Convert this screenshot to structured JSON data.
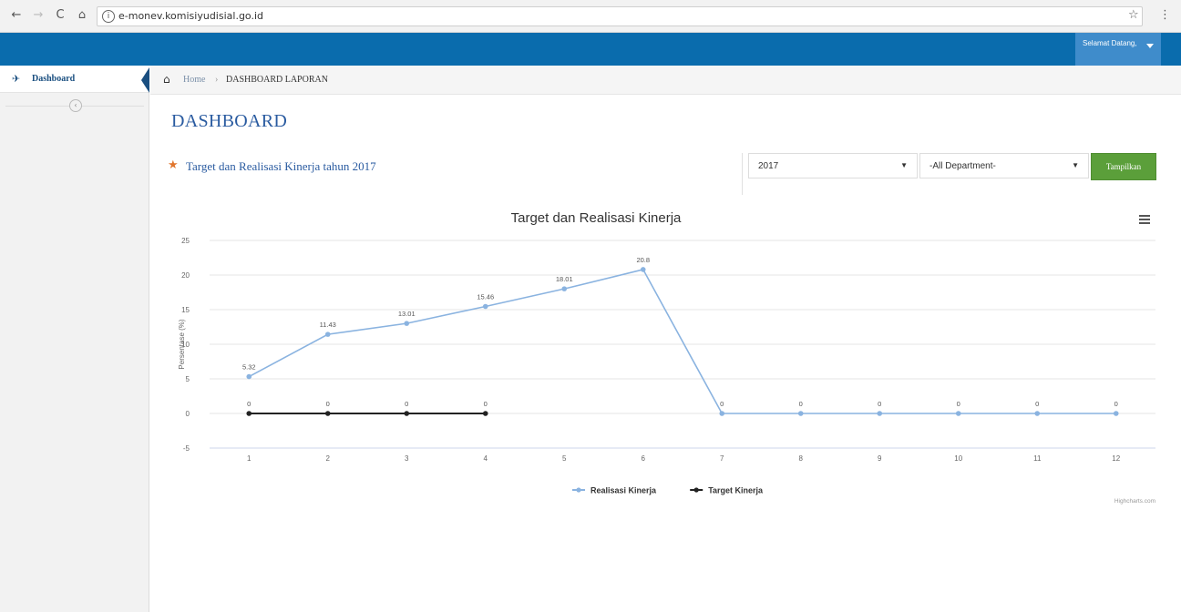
{
  "browser": {
    "back_glyph": "←",
    "forward_glyph": "→",
    "reload_glyph": "C",
    "home_glyph": "⌂",
    "info_glyph": "i",
    "url": "e-monev.komisiyudisial.go.id",
    "bookmark_glyph": "☆",
    "menu_glyph": "⋮"
  },
  "header": {
    "user_label": "Selamat Datang,"
  },
  "sidebar": {
    "items": [
      {
        "label": "Dashboard",
        "icon": "dashboard-icon",
        "glyph": "✈"
      }
    ],
    "collapse_glyph": "‹"
  },
  "breadcrumb": {
    "home_glyph": "⌂",
    "home": "Home",
    "separator": "›",
    "current": "DASHBOARD LAPORAN"
  },
  "main": {
    "title": "DASHBOARD",
    "star_glyph": "★",
    "section_title": "Target dan Realisasi Kinerja tahun 2017",
    "filters": {
      "year": "2017",
      "department": "-All Department-",
      "caret": "▼",
      "button_label": "Tampilkan"
    }
  },
  "colors": {
    "header": "#0a6cad",
    "accent_green": "#5b9f3a",
    "realisasi": "#8ab3e0",
    "target": "#222222"
  },
  "chart_data": {
    "type": "line",
    "title": "Target dan Realisasi Kinerja",
    "xlabel": "",
    "ylabel": "Persentase (%)",
    "categories": [
      "1",
      "2",
      "3",
      "4",
      "5",
      "6",
      "7",
      "8",
      "9",
      "10",
      "11",
      "12"
    ],
    "ylim": [
      -5,
      25
    ],
    "yticks": [
      "25",
      "20",
      "15",
      "10",
      "5",
      "0",
      "-5"
    ],
    "ytick_values": [
      25,
      20,
      15,
      10,
      5,
      0,
      -5
    ],
    "series": [
      {
        "name": "Realisasi Kinerja",
        "values": [
          5.32,
          11.43,
          13.01,
          15.46,
          18.01,
          20.8,
          0,
          0,
          0,
          0,
          0,
          0
        ],
        "labels": [
          "5.32",
          "11.43",
          "13.01",
          "15.46",
          "18.01",
          "20.8",
          "0",
          "0",
          "0",
          "0",
          "0",
          "0"
        ]
      },
      {
        "name": "Target Kinerja",
        "values": [
          0,
          0,
          0,
          0,
          null,
          null,
          null,
          null,
          null,
          null,
          null,
          null
        ],
        "labels": [
          "0",
          "0",
          "0",
          "0",
          "",
          "",
          "",
          "",
          "",
          "",
          "",
          ""
        ]
      }
    ],
    "legend_position": "bottom",
    "credit": "Highcharts.com"
  }
}
